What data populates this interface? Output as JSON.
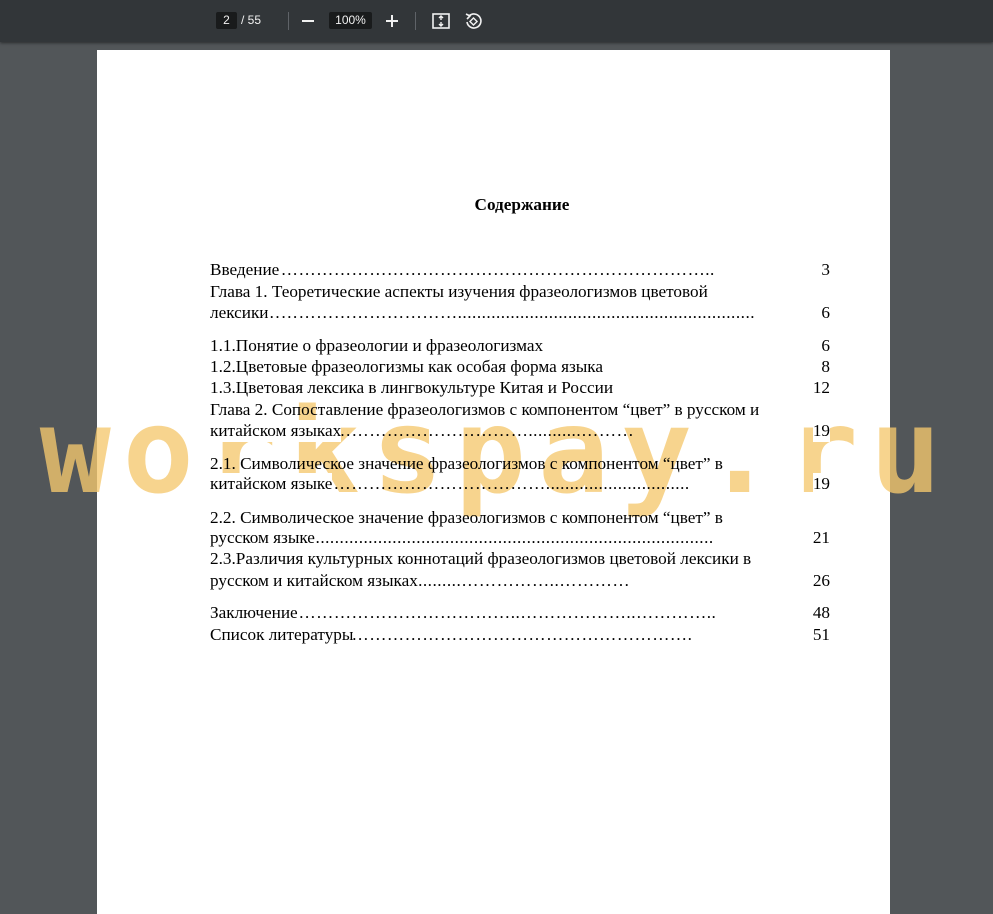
{
  "toolbar": {
    "current_page": "2",
    "total_pages": "/ 55",
    "zoom": "100%",
    "minus_icon": "minus-icon",
    "plus_icon": "plus-icon",
    "fit_icon": "fit-page-icon",
    "rotate_icon": "rotate-icon"
  },
  "document": {
    "title": "Содержание",
    "toc": [
      {
        "text": "Введение",
        "dots": "…………………………………………………………………………..",
        "page": "3"
      },
      {
        "text": "Глава 1. Теоретические аспекты изучения фразеологизмов цветовой"
      },
      {
        "text": "лексики",
        "dots": "……………………………………..............................................................",
        "page": "6"
      },
      {
        "text": "1.1.Понятие о фразеологии и фразеологизмах",
        "dots": " ………..…………………….......",
        "page": "6"
      },
      {
        "text": "1.2.Цветовые фразеологизмы как особая форма языка",
        "dots": "……….............................",
        "page": "8"
      },
      {
        "text": "1.3.Цветовая лексика в лингвокультуре Китая и России",
        "dots": " ……………………..",
        "page": "12"
      },
      {
        "text": "Глава 2. Сопоставление фразеологизмов с компонентом “цвет” в русском и"
      },
      {
        "text": "китайском языках",
        "dots": "………………………………………………...........………",
        "page": "19"
      },
      {
        "text": "2.1. Символическое значение фразеологизмов с компонентом “цвет” в"
      },
      {
        "text": "китайском языке",
        "dots": "……...........……………………………………..............................",
        "page": "19"
      },
      {
        "text": "2.2. Символическое значение фразеологизмов с компонентом “цвет” в"
      },
      {
        "text": "русском языке",
        "dots": ".........................................................................................................",
        "page": "21"
      },
      {
        "text": "2.3.Различия культурных коннотаций фразеологизмов цветовой лексики в"
      },
      {
        "text": "русском и китайском языках",
        "dots": "..……...........................................……………..…………",
        "page": "26"
      },
      {
        "text": "Заключение",
        "dots": "……………………………………………..………………..…………..",
        "page": "48"
      },
      {
        "text": "Список литературы",
        "dots": "……………………………………………………………………….",
        "page": "51"
      }
    ]
  },
  "watermark": "workspay.ru"
}
